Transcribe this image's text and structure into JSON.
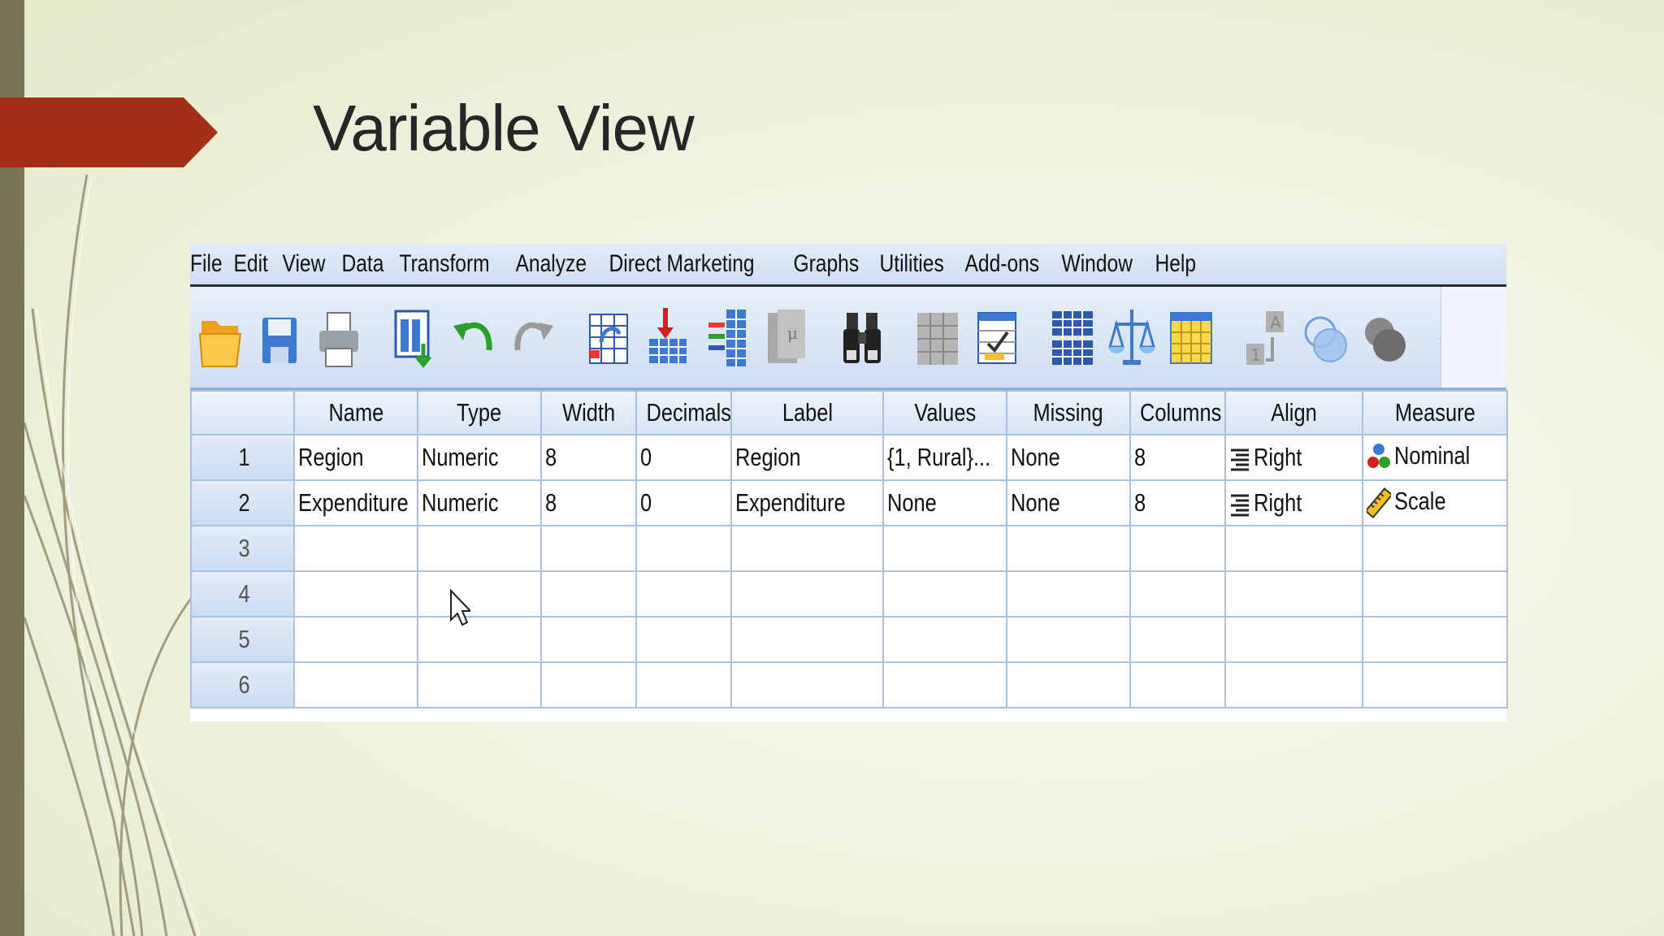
{
  "slide": {
    "title": "Variable View"
  },
  "menu": [
    "File",
    "Edit",
    "View",
    "Data",
    "Transform",
    "Analyze",
    "Direct Marketing",
    "Graphs",
    "Utilities",
    "Add-ons",
    "Window",
    "Help"
  ],
  "toolbar": [
    "open-data-icon",
    "save-icon",
    "print-icon",
    "recall-dialog-icon",
    "undo-icon",
    "redo-icon",
    "go-to-case-icon",
    "go-to-variable-icon",
    "variables-icon",
    "descriptives-icon",
    "find-icon",
    "insert-cases-icon",
    "insert-variable-icon",
    "split-file-icon",
    "weight-cases-icon",
    "select-cases-icon",
    "value-labels-icon",
    "use-sets-icon",
    "show-all-variables-icon",
    "spell-check-icon"
  ],
  "grid": {
    "columns": [
      "Name",
      "Type",
      "Width",
      "Decimals",
      "Label",
      "Values",
      "Missing",
      "Columns",
      "Align",
      "Measure"
    ],
    "rows": [
      {
        "num": "1",
        "name": "Region",
        "type": "Numeric",
        "width": "8",
        "decimals": "0",
        "label": "Region",
        "values": "{1, Rural}...",
        "missing": "None",
        "columns": "8",
        "align": "Right",
        "measure": "Nominal",
        "measure_icon": "nominal-icon"
      },
      {
        "num": "2",
        "name": "Expenditure",
        "type": "Numeric",
        "width": "8",
        "decimals": "0",
        "label": "Expenditure",
        "values": "None",
        "missing": "None",
        "columns": "8",
        "align": "Right",
        "measure": "Scale",
        "measure_icon": "scale-ruler-icon"
      },
      {
        "num": "3"
      },
      {
        "num": "4"
      },
      {
        "num": "5"
      },
      {
        "num": "6"
      }
    ]
  },
  "colors": {
    "accent": "#a52f16",
    "sidebar": "#7b7356",
    "grid_line": "#a9c1de",
    "header_bg": "#d6e4f5"
  }
}
